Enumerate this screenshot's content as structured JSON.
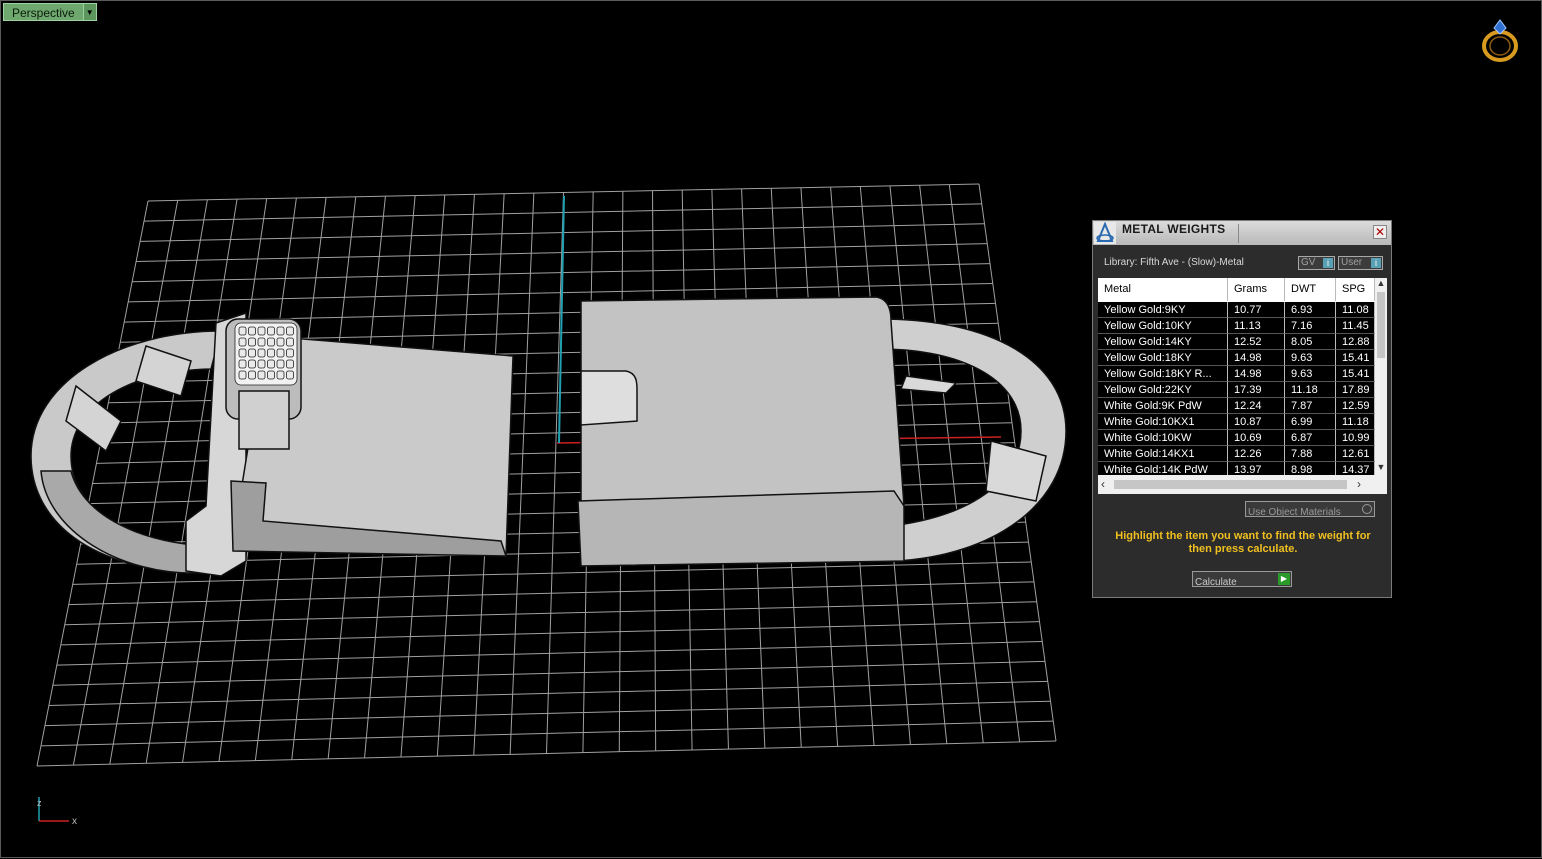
{
  "viewport": {
    "title": "Perspective",
    "axis_labels": {
      "z": "z",
      "x": "x"
    }
  },
  "panel": {
    "title": "METAL WEIGHTS",
    "library": "Library: Fifth Ave - (Slow)-Metal",
    "toggle_gv": "GV",
    "toggle_user": "User",
    "toggle_icon": "i",
    "columns": [
      "Metal",
      "Grams",
      "DWT",
      "SPG"
    ],
    "rows": [
      {
        "metal": "Yellow Gold:9KY",
        "grams": "10.77",
        "dwt": "6.93",
        "spg": "11.08"
      },
      {
        "metal": "Yellow Gold:10KY",
        "grams": "11.13",
        "dwt": "7.16",
        "spg": "11.45"
      },
      {
        "metal": "Yellow Gold:14KY",
        "grams": "12.52",
        "dwt": "8.05",
        "spg": "12.88"
      },
      {
        "metal": "Yellow Gold:18KY",
        "grams": "14.98",
        "dwt": "9.63",
        "spg": "15.41"
      },
      {
        "metal": "Yellow Gold:18KY R...",
        "grams": "14.98",
        "dwt": "9.63",
        "spg": "15.41"
      },
      {
        "metal": "Yellow Gold:22KY",
        "grams": "17.39",
        "dwt": "11.18",
        "spg": "17.89"
      },
      {
        "metal": "White Gold:9K PdW",
        "grams": "12.24",
        "dwt": "7.87",
        "spg": "12.59"
      },
      {
        "metal": "White Gold:10KX1",
        "grams": "10.87",
        "dwt": "6.99",
        "spg": "11.18"
      },
      {
        "metal": "White Gold:10KW",
        "grams": "10.69",
        "dwt": "6.87",
        "spg": "10.99"
      },
      {
        "metal": "White Gold:14KX1",
        "grams": "12.26",
        "dwt": "7.88",
        "spg": "12.61"
      },
      {
        "metal": "White Gold:14K PdW",
        "grams": "13.97",
        "dwt": "8.98",
        "spg": "14.37"
      }
    ],
    "use_object_materials": "Use Object Materials",
    "hint": "Highlight the item you want to find the weight for then press calculate.",
    "calculate": "Calculate"
  },
  "colors": {
    "background": "#000000",
    "grid": "#bdbdbd",
    "model_shade": "#c8c8c8",
    "title_tab": "#6fa86f",
    "hint_text": "#f0c020",
    "x_axis": "#cc2020",
    "z_axis": "#20a0b0"
  },
  "icons": {
    "viewport_dropdown": "chevron-down-icon",
    "app_logo": "ring-icon",
    "panel_logo": "metal-weights-icon",
    "close": "close-icon",
    "axis": "axis-indicator-icon"
  }
}
